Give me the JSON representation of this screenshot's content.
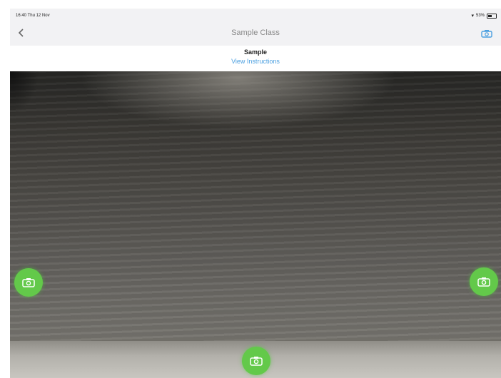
{
  "status_bar": {
    "time": "16:40",
    "date": "Thu 12 Nov",
    "battery_text": "53%"
  },
  "nav": {
    "title": "Sample Class",
    "back_icon": "chevron-left-icon",
    "action_icon": "camera-icon"
  },
  "header": {
    "title": "Sample",
    "link": "View Instructions"
  },
  "capture_buttons": {
    "icon": "camera-icon",
    "color": "#63c94a",
    "positions": [
      "left",
      "right",
      "bottom"
    ]
  },
  "colors": {
    "accent": "#4a9fe0",
    "capture": "#63c94a"
  }
}
